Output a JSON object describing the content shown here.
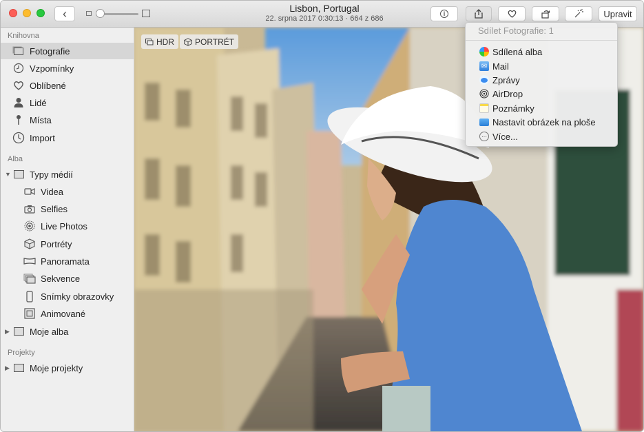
{
  "window": {
    "title": "Lisbon, Portugal",
    "subtitle": "22. srpna 2017 0:30:13  ·  664 z 686",
    "buttons": {
      "back": "‹",
      "edit": "Upravit"
    }
  },
  "toolbar_icons": [
    "info-icon",
    "share-icon",
    "heart-icon",
    "rotate-icon",
    "magic-wand-icon"
  ],
  "sidebar": {
    "library_header": "Knihovna",
    "library": [
      {
        "label": "Fotografie",
        "icon": "photos-icon"
      },
      {
        "label": "Vzpomínky",
        "icon": "memories-icon"
      },
      {
        "label": "Oblíbené",
        "icon": "heart-icon"
      },
      {
        "label": "Lidé",
        "icon": "person-icon"
      },
      {
        "label": "Místa",
        "icon": "pin-icon"
      },
      {
        "label": "Import",
        "icon": "clock-icon"
      }
    ],
    "albums_header": "Alba",
    "media_types": "Typy médií",
    "media": [
      {
        "label": "Videa",
        "icon": "video-icon"
      },
      {
        "label": "Selfies",
        "icon": "camera-icon"
      },
      {
        "label": "Live Photos",
        "icon": "live-icon"
      },
      {
        "label": "Portréty",
        "icon": "cube-icon"
      },
      {
        "label": "Panoramata",
        "icon": "panorama-icon"
      },
      {
        "label": "Sekvence",
        "icon": "burst-icon"
      },
      {
        "label": "Snímky obrazovky",
        "icon": "phone-icon"
      },
      {
        "label": "Animované",
        "icon": "animated-icon"
      }
    ],
    "my_albums": "Moje alba",
    "projects_header": "Projekty",
    "my_projects": "Moje projekty"
  },
  "photo": {
    "badges": {
      "hdr": "HDR",
      "portrait": "PORTRÉT"
    }
  },
  "share_menu": {
    "title": "Sdílet Fotografie: 1",
    "items": [
      {
        "label": "Sdílená alba",
        "icon": "shared-albums-icon"
      },
      {
        "label": "Mail",
        "icon": "mail-icon"
      },
      {
        "label": "Zprávy",
        "icon": "messages-icon"
      },
      {
        "label": "AirDrop",
        "icon": "airdrop-icon"
      },
      {
        "label": "Poznámky",
        "icon": "notes-icon"
      },
      {
        "label": "Nastavit obrázek na ploše",
        "icon": "desktop-icon"
      },
      {
        "label": "Více...",
        "icon": "more-icon"
      }
    ]
  },
  "colors": {
    "close": "#fc5f57",
    "minimize": "#fdbc2e",
    "zoom": "#28c840",
    "selection": "#d6d6d6"
  }
}
